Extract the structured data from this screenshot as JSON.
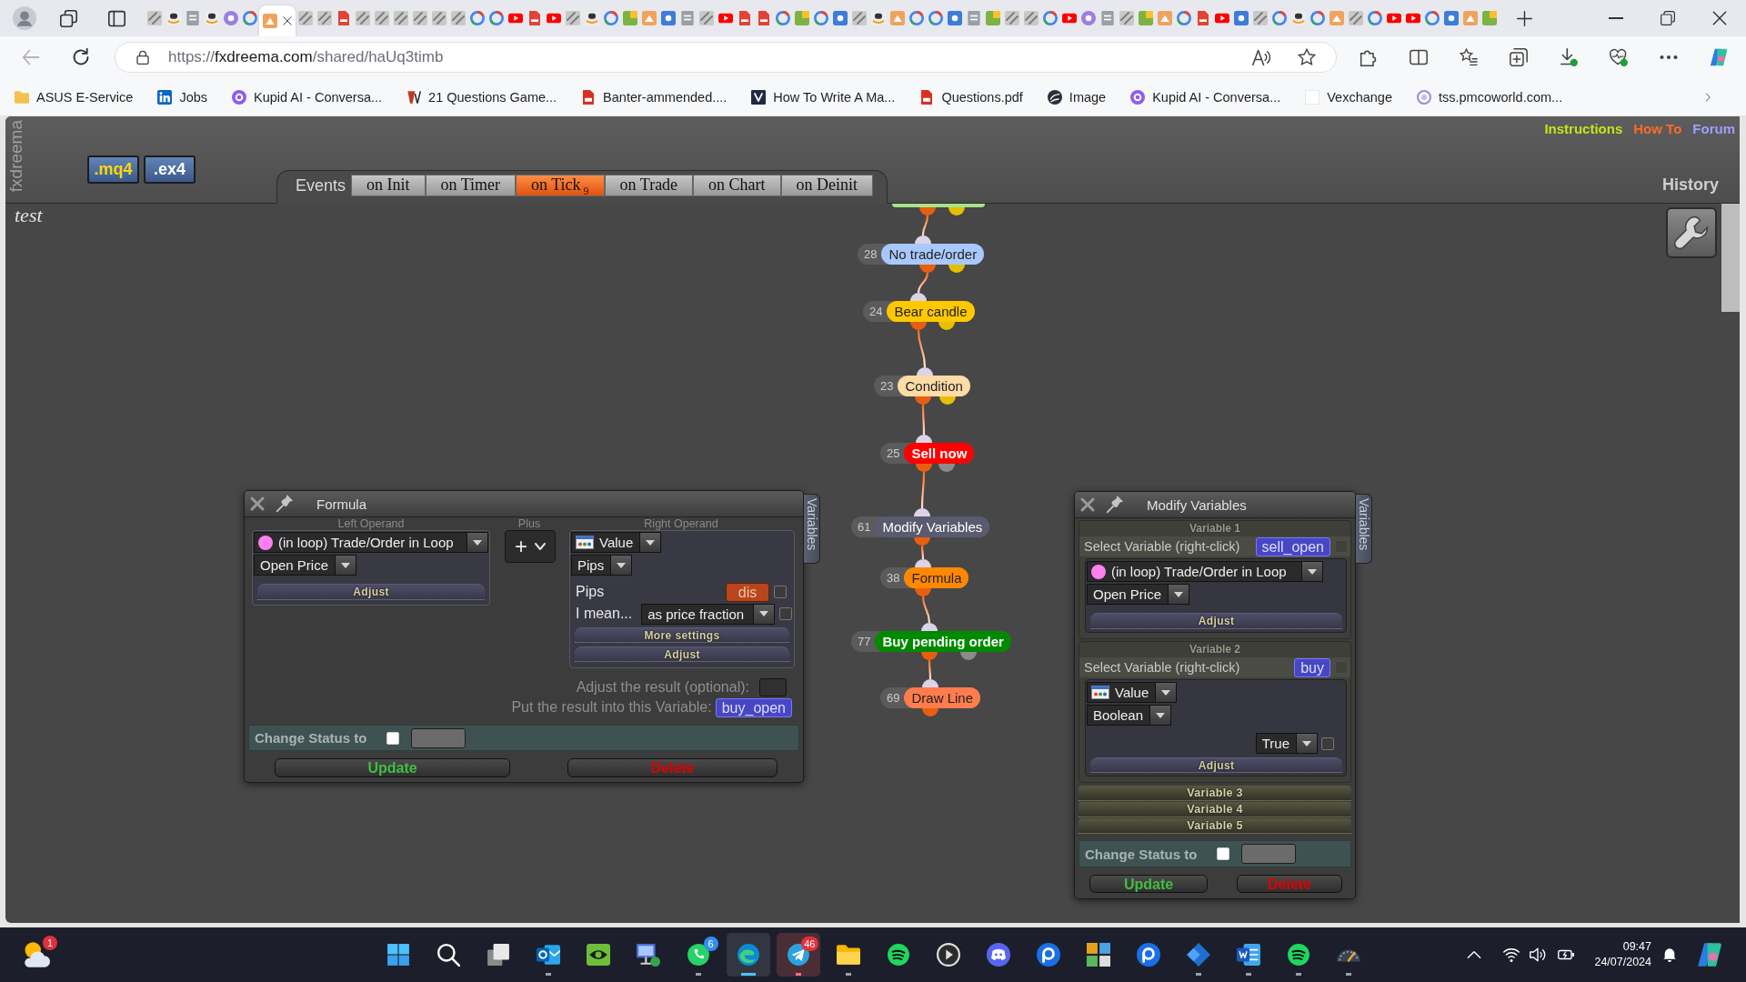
{
  "browser": {
    "tabs": [
      {
        "selected": false
      },
      {
        "selected": false
      },
      {
        "selected": false
      },
      {
        "selected": false
      },
      {
        "selected": false
      },
      {
        "selected": false
      },
      {
        "selected": true
      },
      {
        "selected": false
      },
      {
        "selected": false
      },
      {
        "selected": false
      },
      {
        "selected": false
      },
      {
        "selected": false
      },
      {
        "selected": false
      },
      {
        "selected": false
      },
      {
        "selected": false
      },
      {
        "selected": false
      },
      {
        "selected": false
      },
      {
        "selected": false
      },
      {
        "selected": false
      },
      {
        "selected": false
      },
      {
        "selected": false
      },
      {
        "selected": false
      },
      {
        "selected": false
      },
      {
        "selected": false
      },
      {
        "selected": false
      },
      {
        "selected": false
      },
      {
        "selected": false
      },
      {
        "selected": false
      },
      {
        "selected": false
      },
      {
        "selected": false
      },
      {
        "selected": false
      },
      {
        "selected": false
      },
      {
        "selected": false
      },
      {
        "selected": false
      },
      {
        "selected": false
      },
      {
        "selected": false
      },
      {
        "selected": false
      },
      {
        "selected": false
      },
      {
        "selected": false
      },
      {
        "selected": false
      },
      {
        "selected": false
      },
      {
        "selected": false
      },
      {
        "selected": false
      },
      {
        "selected": false
      },
      {
        "selected": false
      },
      {
        "selected": false
      },
      {
        "selected": false
      },
      {
        "selected": false
      },
      {
        "selected": false
      },
      {
        "selected": false
      },
      {
        "selected": false
      },
      {
        "selected": false
      },
      {
        "selected": false
      },
      {
        "selected": false
      },
      {
        "selected": false
      },
      {
        "selected": false
      },
      {
        "selected": false
      },
      {
        "selected": false
      },
      {
        "selected": false
      },
      {
        "selected": false
      },
      {
        "selected": false
      },
      {
        "selected": false
      },
      {
        "selected": false
      },
      {
        "selected": false
      },
      {
        "selected": false
      },
      {
        "selected": false
      },
      {
        "selected": false
      },
      {
        "selected": false
      },
      {
        "selected": false
      },
      {
        "selected": false
      }
    ],
    "address_bar": {
      "back_disabled": true,
      "url": {
        "scheme": "https://",
        "host": "fxdreema.com",
        "path": "/shared/haUq3timb"
      }
    },
    "bookmarks": [
      "ASUS E-Service",
      "Jobs",
      "Kupid AI - Conversa...",
      "21 Questions Game...",
      "Banter-ammended....",
      "How To Write A Ma...",
      "Questions.pdf",
      "Image",
      "Kupid AI - Conversa...",
      "Vexchange",
      "tss.pmcoworld.com..."
    ]
  },
  "app": {
    "logo": "fxdreema",
    "export_buttons": [
      {
        "label": ".mq4",
        "kind": "source"
      },
      {
        "label": ".ex4",
        "kind": "compiled"
      }
    ],
    "events": {
      "label": "Events",
      "tabs": [
        {
          "label": "on Init",
          "selected": false
        },
        {
          "label": "on Timer",
          "selected": false
        },
        {
          "label": "on Tick",
          "count": "9",
          "selected": true
        },
        {
          "label": "on Trade",
          "selected": false
        },
        {
          "label": "on Chart",
          "selected": false
        },
        {
          "label": "on Deinit",
          "selected": false
        }
      ]
    },
    "top_links": [
      {
        "label": "Instructions",
        "color": "#c6e21c"
      },
      {
        "label": "How To",
        "color": "#ff6a2a"
      },
      {
        "label": "Forum",
        "color": "#9e9eff"
      }
    ],
    "history": "History",
    "project_name": "test",
    "flow": {
      "nodes": [
        {
          "id": "28",
          "label": "No trade/order",
          "color": "#a8c8ff",
          "kind": "condition"
        },
        {
          "id": "24",
          "label": "Bear candle",
          "color": "#ffc800",
          "kind": "condition"
        },
        {
          "id": "23",
          "label": "Condition",
          "color": "#ffdba6",
          "kind": "condition"
        },
        {
          "id": "25",
          "label": "Sell now",
          "color": "#ff0000",
          "kind": "trade"
        },
        {
          "id": "61",
          "label": "Modify Variables",
          "color": "#5a5b6e",
          "kind": "action"
        },
        {
          "id": "38",
          "label": "Formula",
          "color": "#ff8800",
          "kind": "action"
        },
        {
          "id": "77",
          "label": "Buy pending order",
          "color": "#008a00",
          "kind": "trade"
        },
        {
          "id": "69",
          "label": "Draw Line",
          "color": "#ff7c4c",
          "kind": "action"
        }
      ]
    },
    "formula_panel": {
      "title": "Formula",
      "side_tab": "Variables",
      "left_operand": {
        "heading": "Left Operand",
        "source": {
          "label": "(in loop) Trade/Order in Loop",
          "kind": "loop"
        },
        "field": "Open Price",
        "adjust": "Adjust"
      },
      "operator": {
        "heading": "Plus",
        "symbol": "+"
      },
      "right_operand": {
        "heading": "Right Operand",
        "source": {
          "label": "Value",
          "kind": "value"
        },
        "field": "Pips",
        "rows": [
          {
            "kind": "input",
            "label": "Pips",
            "value": "dis",
            "checked": false
          },
          {
            "kind": "select",
            "label": "I mean...",
            "value": "as price fraction",
            "checked": false
          }
        ],
        "more_settings": "More settings",
        "adjust": "Adjust"
      },
      "adjust_result": {
        "label": "Adjust the result (optional):"
      },
      "result_variable": {
        "label": "Put the result into this Variable:",
        "value": "buy_open"
      },
      "status": {
        "label": "Change Status to",
        "checked": false
      },
      "buttons": [
        {
          "label": "Update",
          "kind": "update"
        },
        {
          "label": "Delete",
          "kind": "delete"
        }
      ]
    },
    "modify_panel": {
      "title": "Modify Variables",
      "side_tab": "Variables",
      "variables": [
        {
          "heading": "Variable 1",
          "expanded": true,
          "select_label": "Select Variable (right-click)",
          "variable": "sell_open",
          "checked": false,
          "source": {
            "label": "(in loop) Trade/Order in Loop",
            "kind": "loop"
          },
          "field": "Open Price",
          "adjust": "Adjust"
        },
        {
          "heading": "Variable 2",
          "expanded": true,
          "select_label": "Select Variable (right-click)",
          "variable": "buy",
          "checked": false,
          "source": {
            "label": "Value",
            "kind": "value"
          },
          "field": "Boolean",
          "value": {
            "label": "True",
            "checked": false
          },
          "adjust": "Adjust"
        },
        {
          "heading": "Variable 3",
          "expanded": false
        },
        {
          "heading": "Variable 4",
          "expanded": false
        },
        {
          "heading": "Variable 5",
          "expanded": false
        }
      ],
      "status": {
        "label": "Change Status to",
        "checked": false
      },
      "buttons": [
        {
          "label": "Update",
          "kind": "update"
        },
        {
          "label": "Delete",
          "kind": "delete"
        }
      ]
    }
  },
  "taskbar": {
    "weather": {
      "badge": {
        "text": "1",
        "color": "#e0313b"
      }
    },
    "apps": [
      {
        "running": false,
        "selected": false,
        "flashing": false
      },
      {
        "running": false,
        "selected": false,
        "flashing": false
      },
      {
        "running": false,
        "selected": false,
        "flashing": false
      },
      {
        "running": true,
        "selected": false,
        "flashing": false
      },
      {
        "running": false,
        "selected": false,
        "flashing": false
      },
      {
        "running": false,
        "selected": false,
        "flashing": false
      },
      {
        "running": true,
        "selected": false,
        "flashing": false,
        "badge": {
          "text": "6",
          "color": "#2f8ff0"
        }
      },
      {
        "running": true,
        "selected": true,
        "flashing": false
      },
      {
        "running": true,
        "selected": false,
        "flashing": true,
        "badge": {
          "text": "46",
          "color": "#e0313b"
        }
      },
      {
        "running": true,
        "selected": false,
        "flashing": false
      },
      {
        "running": false,
        "selected": false,
        "flashing": false
      },
      {
        "running": false,
        "selected": false,
        "flashing": false
      },
      {
        "running": false,
        "selected": false,
        "flashing": false
      },
      {
        "running": false,
        "selected": false,
        "flashing": false
      },
      {
        "running": false,
        "selected": false,
        "flashing": false
      },
      {
        "running": false,
        "selected": false,
        "flashing": false
      },
      {
        "running": true,
        "selected": false,
        "flashing": false
      },
      {
        "running": true,
        "selected": false,
        "flashing": false
      },
      {
        "running": true,
        "selected": false,
        "flashing": false
      },
      {
        "running": true,
        "selected": false,
        "flashing": false
      }
    ],
    "clock": {
      "time": "09:47",
      "date": "24/07/2024"
    }
  }
}
